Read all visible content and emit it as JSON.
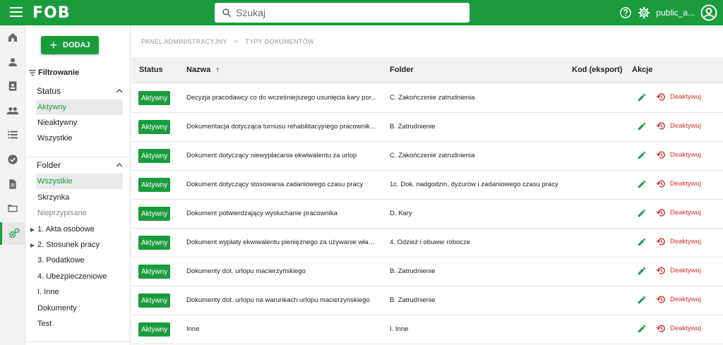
{
  "header": {
    "logo": "FOB",
    "search_placeholder": "Szukaj",
    "username": "public_a...",
    "icons": [
      "menu-icon",
      "help-icon",
      "gear-icon",
      "account-circle-icon"
    ]
  },
  "rail": {
    "items": [
      "home-icon",
      "person-icon",
      "contact-card-icon",
      "group-icon",
      "list-icon",
      "check-circle-icon",
      "document-icon",
      "folder-icon",
      "settings-gears-icon"
    ],
    "active_index": 8
  },
  "filters": {
    "add_label": "DODAJ",
    "title": "Filtrowanie",
    "status": {
      "label": "Status",
      "options": [
        "Aktywny",
        "Nieaktywny",
        "Wszystkie"
      ]
    },
    "folder": {
      "label": "Folder",
      "options": [
        "Wszystkie",
        "Skrzynka",
        "Nieprzypisane",
        "1. Akta osobowe",
        "2. Stosunek pracy",
        "3. Podatkowe",
        "4. Ubezpieczeniowe",
        "I. Inne",
        "Dokumenty",
        "Test"
      ]
    }
  },
  "breadcrumb": [
    "PANEL ADMINISTRACYJNY",
    ">",
    "TYPY DOKUMENTÓW"
  ],
  "table": {
    "columns": [
      "Status",
      "Nazwa",
      "Folder",
      "Kod (eksport)",
      "Akcje"
    ],
    "sort_indicator": "↑",
    "rows": [
      {
        "status": "Aktywny",
        "name": "Decyzja pracodawcy co do wcześniejszego usunięcia kary por...",
        "folder": "C. Zakończenie zatrudnienia",
        "code": "",
        "action": "Deaktywuj"
      },
      {
        "status": "Aktywny",
        "name": "Dokumentacja dotycząca turnusu rehabilitacyjnego pracownik...",
        "folder": "B. Zatrudnienie",
        "code": "",
        "action": "Deaktywuj"
      },
      {
        "status": "Aktywny",
        "name": "Dokument dotyczący niewypłacania ekwiwalentu za urlop",
        "folder": "C. Zakończenie zatrudnienia",
        "code": "",
        "action": "Deaktywuj"
      },
      {
        "status": "Aktywny",
        "name": "Dokument dotyczący stosowania zadaniowego czasu pracy",
        "folder": "1c. Dok. nadgodzin, dyżurów i zadaniowego czasu pracy",
        "code": "",
        "action": "Deaktywuj"
      },
      {
        "status": "Aktywny",
        "name": "Dokument potwierdzający wysłuchanie pracownika",
        "folder": "D. Kary",
        "code": "",
        "action": "Deaktywuj"
      },
      {
        "status": "Aktywny",
        "name": "Dokument wypłaty ekwiwalentu pieniężnego za używanie włas...",
        "folder": "4. Odzież i obuwie robocze",
        "code": "",
        "action": "Deaktywuj"
      },
      {
        "status": "Aktywny",
        "name": "Dokumenty dot. urlopu macierzyńskiego",
        "folder": "B. Zatrudnienie",
        "code": "",
        "action": "Deaktywuj"
      },
      {
        "status": "Aktywny",
        "name": "Dokumenty dot. urlopu na warunkach urlopu macierzyńskiego",
        "folder": "B. Zatrudnienie",
        "code": "",
        "action": "Deaktywuj"
      },
      {
        "status": "Aktywny",
        "name": "Inne",
        "folder": "I. Inne",
        "code": "",
        "action": "Deaktywuj"
      }
    ]
  },
  "colors": {
    "brand": "#1a9c3e",
    "danger": "#d32f2f"
  }
}
